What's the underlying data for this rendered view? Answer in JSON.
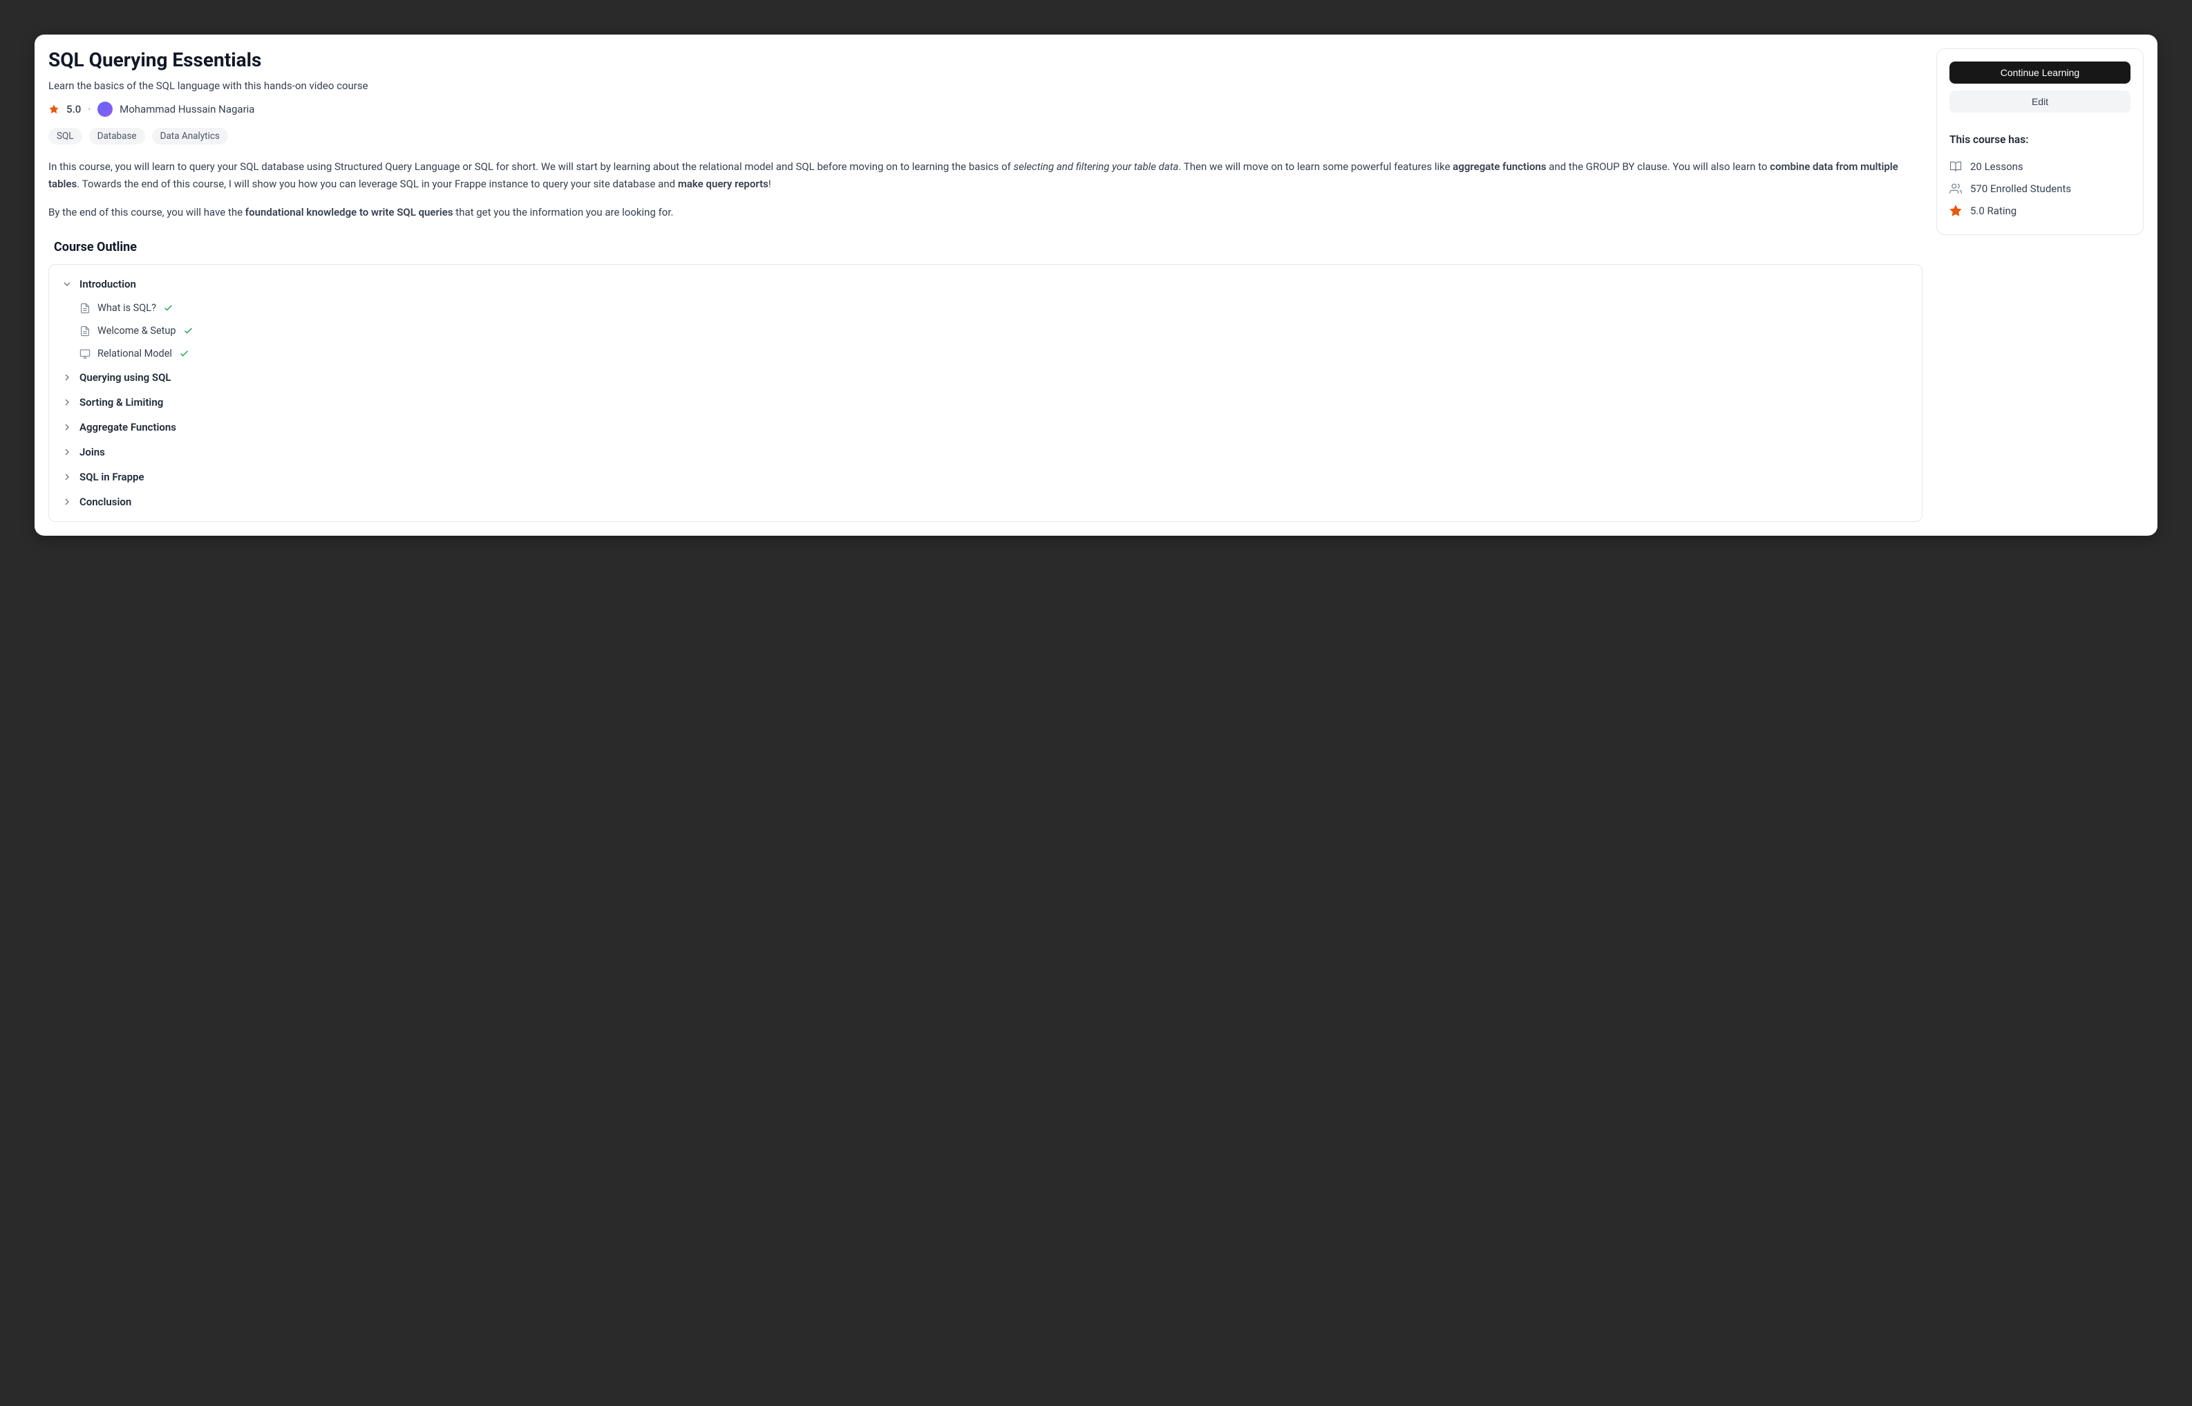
{
  "title": "SQL Querying Essentials",
  "subtitle": "Learn the basics of the SQL language with this hands-on video course",
  "rating": "5.0",
  "instructor": "Mohammad Hussain Nagaria",
  "tags": [
    "SQL",
    "Database",
    "Data Analytics"
  ],
  "description_p1_html": "In this course, you will learn to query your SQL database using Structured Query Language or SQL for short. We will start by learning about the relational model and SQL before moving on to learning the basics of <em>selecting and filtering your table data</em>. Then we will move on to learn some powerful features like <strong>aggregate functions</strong> and the GROUP BY clause. You will also learn to <strong>combine data from multiple tables</strong>. Towards the end of this course, I will show you how you can leverage SQL in your Frappe instance to query your site database and <strong>make query reports</strong>!",
  "description_p2_html": "By the end of this course, you will have the <strong>foundational knowledge to write SQL queries</strong> that get you the information you are looking for.",
  "outline_title": "Course Outline",
  "chapters": [
    {
      "title": "Introduction",
      "expanded": true,
      "lessons": [
        {
          "title": "What is SQL?",
          "icon": "text",
          "done": true
        },
        {
          "title": "Welcome & Setup",
          "icon": "text",
          "done": true
        },
        {
          "title": "Relational Model",
          "icon": "video",
          "done": true
        }
      ]
    },
    {
      "title": "Querying using SQL",
      "expanded": false
    },
    {
      "title": "Sorting & Limiting",
      "expanded": false
    },
    {
      "title": "Aggregate Functions",
      "expanded": false
    },
    {
      "title": "Joins",
      "expanded": false
    },
    {
      "title": "SQL in Frappe",
      "expanded": false
    },
    {
      "title": "Conclusion",
      "expanded": false
    }
  ],
  "sidebar": {
    "primary_btn": "Continue Learning",
    "secondary_btn": "Edit",
    "heading": "This course has:",
    "lessons": "20 Lessons",
    "students": "570 Enrolled Students",
    "rating": "5.0 Rating"
  }
}
